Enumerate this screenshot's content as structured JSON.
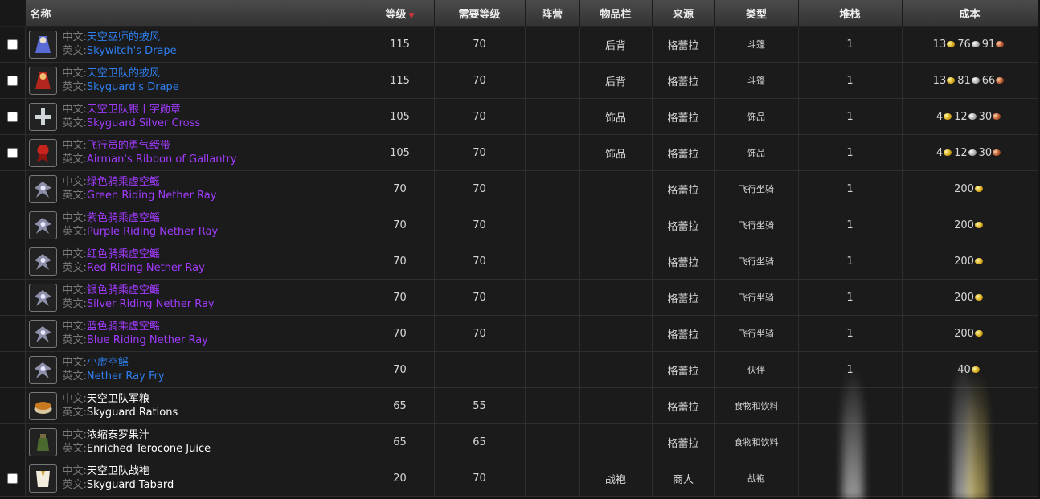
{
  "header": {
    "name": "名称",
    "level": "等级",
    "req_level": "需要等级",
    "faction": "阵营",
    "slot": "物品栏",
    "source": "来源",
    "type": "类型",
    "stack": "堆栈",
    "cost": "成本"
  },
  "labels": {
    "cn": "中文:",
    "en": "英文:"
  },
  "colors": {
    "blue": "#2f7ff0",
    "purple": "#a23bff",
    "white": "#ffffff",
    "sort_arrow": "#e0303a"
  },
  "rows": [
    {
      "checkbox": true,
      "icon": "cloak-icon",
      "cn": "天空巫师的披风",
      "en": "Skywitch's Drape",
      "quality": "blue",
      "level": "115",
      "req": "70",
      "faction": "",
      "slot": "后背",
      "source": "格蕾拉",
      "type": "斗篷",
      "stack": "1",
      "cost": {
        "gold": "13",
        "silver": "76",
        "copper": "91"
      }
    },
    {
      "checkbox": true,
      "icon": "red-cloak-icon",
      "cn": "天空卫队的披风",
      "en": "Skyguard's Drape",
      "quality": "blue",
      "level": "115",
      "req": "70",
      "faction": "",
      "slot": "后背",
      "source": "格蕾拉",
      "type": "斗篷",
      "stack": "1",
      "cost": {
        "gold": "13",
        "silver": "81",
        "copper": "66"
      }
    },
    {
      "checkbox": true,
      "icon": "silver-cross-icon",
      "cn": "天空卫队银十字勋章",
      "en": "Skyguard Silver Cross",
      "quality": "purple",
      "level": "105",
      "req": "70",
      "faction": "",
      "slot": "饰品",
      "source": "格蕾拉",
      "type": "饰品",
      "stack": "1",
      "cost": {
        "gold": "4",
        "silver": "12",
        "copper": "30"
      }
    },
    {
      "checkbox": true,
      "icon": "ribbon-icon",
      "cn": "飞行员的勇气绶带",
      "en": "Airman's Ribbon of Gallantry",
      "quality": "purple",
      "level": "105",
      "req": "70",
      "faction": "",
      "slot": "饰品",
      "source": "格蕾拉",
      "type": "饰品",
      "stack": "1",
      "cost": {
        "gold": "4",
        "silver": "12",
        "copper": "30"
      }
    },
    {
      "checkbox": false,
      "icon": "nether-ray-icon",
      "cn": "绿色骑乘虚空鳐",
      "en": "Green Riding Nether Ray",
      "quality": "purple",
      "level": "70",
      "req": "70",
      "faction": "",
      "slot": "",
      "source": "格蕾拉",
      "type": "飞行坐骑",
      "stack": "1",
      "cost": {
        "gold": "200"
      }
    },
    {
      "checkbox": false,
      "icon": "nether-ray-icon",
      "cn": "紫色骑乘虚空鳐",
      "en": "Purple Riding Nether Ray",
      "quality": "purple",
      "level": "70",
      "req": "70",
      "faction": "",
      "slot": "",
      "source": "格蕾拉",
      "type": "飞行坐骑",
      "stack": "1",
      "cost": {
        "gold": "200"
      }
    },
    {
      "checkbox": false,
      "icon": "nether-ray-icon",
      "cn": "红色骑乘虚空鳐",
      "en": "Red Riding Nether Ray",
      "quality": "purple",
      "level": "70",
      "req": "70",
      "faction": "",
      "slot": "",
      "source": "格蕾拉",
      "type": "飞行坐骑",
      "stack": "1",
      "cost": {
        "gold": "200"
      }
    },
    {
      "checkbox": false,
      "icon": "nether-ray-icon",
      "cn": "银色骑乘虚空鳐",
      "en": "Silver Riding Nether Ray",
      "quality": "purple",
      "level": "70",
      "req": "70",
      "faction": "",
      "slot": "",
      "source": "格蕾拉",
      "type": "飞行坐骑",
      "stack": "1",
      "cost": {
        "gold": "200"
      }
    },
    {
      "checkbox": false,
      "icon": "nether-ray-icon",
      "cn": "蓝色骑乘虚空鳐",
      "en": "Blue Riding Nether Ray",
      "quality": "purple",
      "level": "70",
      "req": "70",
      "faction": "",
      "slot": "",
      "source": "格蕾拉",
      "type": "飞行坐骑",
      "stack": "1",
      "cost": {
        "gold": "200"
      }
    },
    {
      "checkbox": false,
      "icon": "nether-ray-icon",
      "cn": "小虚空鳐",
      "en": "Nether Ray Fry",
      "quality": "blue",
      "level": "70",
      "req": "",
      "faction": "",
      "slot": "",
      "source": "格蕾拉",
      "type": "伙伴",
      "stack": "1",
      "cost": {
        "gold": "40"
      }
    },
    {
      "checkbox": false,
      "icon": "rations-icon",
      "cn": "天空卫队军粮",
      "en": "Skyguard Rations",
      "quality": "white",
      "level": "65",
      "req": "55",
      "faction": "",
      "slot": "",
      "source": "格蕾拉",
      "type": "食物和饮料",
      "stack": "",
      "cost": {}
    },
    {
      "checkbox": false,
      "icon": "juice-icon",
      "cn": "浓缩泰罗果汁",
      "en": "Enriched Terocone Juice",
      "quality": "white",
      "level": "65",
      "req": "65",
      "faction": "",
      "slot": "",
      "source": "格蕾拉",
      "type": "食物和饮料",
      "stack": "",
      "cost": {}
    },
    {
      "checkbox": true,
      "icon": "tabard-icon",
      "cn": "天空卫队战袍",
      "en": "Skyguard Tabard",
      "quality": "white",
      "level": "20",
      "req": "70",
      "faction": "",
      "slot": "战袍",
      "source": "商人",
      "type": "战袍",
      "stack": "",
      "cost": {}
    }
  ]
}
